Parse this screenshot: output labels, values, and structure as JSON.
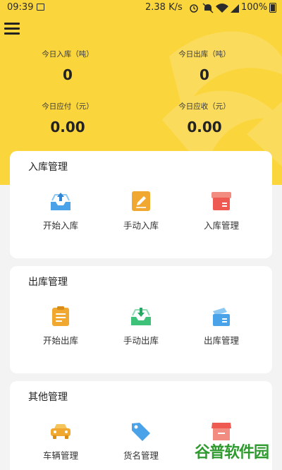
{
  "status_bar": {
    "time": "09:39",
    "network_speed": "2.38 K/s",
    "battery": "100%"
  },
  "menu_icon": "hamburger-menu-icon",
  "stats": {
    "inbound_label": "今日入库（吨）",
    "inbound_value": "0",
    "outbound_label": "今日出库（吨）",
    "outbound_value": "0",
    "payable_label": "今日应付（元）",
    "payable_value": "0.00",
    "receivable_label": "今日应收（元）",
    "receivable_value": "0.00"
  },
  "sections": [
    {
      "title": "入库管理",
      "items": [
        {
          "label": "开始入库",
          "icon": "tray-upload-icon"
        },
        {
          "label": "手动入库",
          "icon": "pencil-edit-icon"
        },
        {
          "label": "入库管理",
          "icon": "box-icon"
        }
      ]
    },
    {
      "title": "出库管理",
      "items": [
        {
          "label": "开始出库",
          "icon": "clipboard-icon"
        },
        {
          "label": "手动出库",
          "icon": "tray-download-icon"
        },
        {
          "label": "出库管理",
          "icon": "open-box-icon"
        }
      ]
    },
    {
      "title": "其他管理",
      "items": [
        {
          "label": "车辆管理",
          "icon": "car-icon"
        },
        {
          "label": "货名管理",
          "icon": "tag-icon"
        },
        {
          "label": "",
          "icon": "store-icon"
        }
      ]
    }
  ],
  "watermark": "谷普软件园",
  "colors": {
    "header_bg": "#fad53c",
    "blue": "#4aa3e8",
    "orange": "#f0a830",
    "red": "#ee5a52",
    "green": "#3ec27a"
  }
}
